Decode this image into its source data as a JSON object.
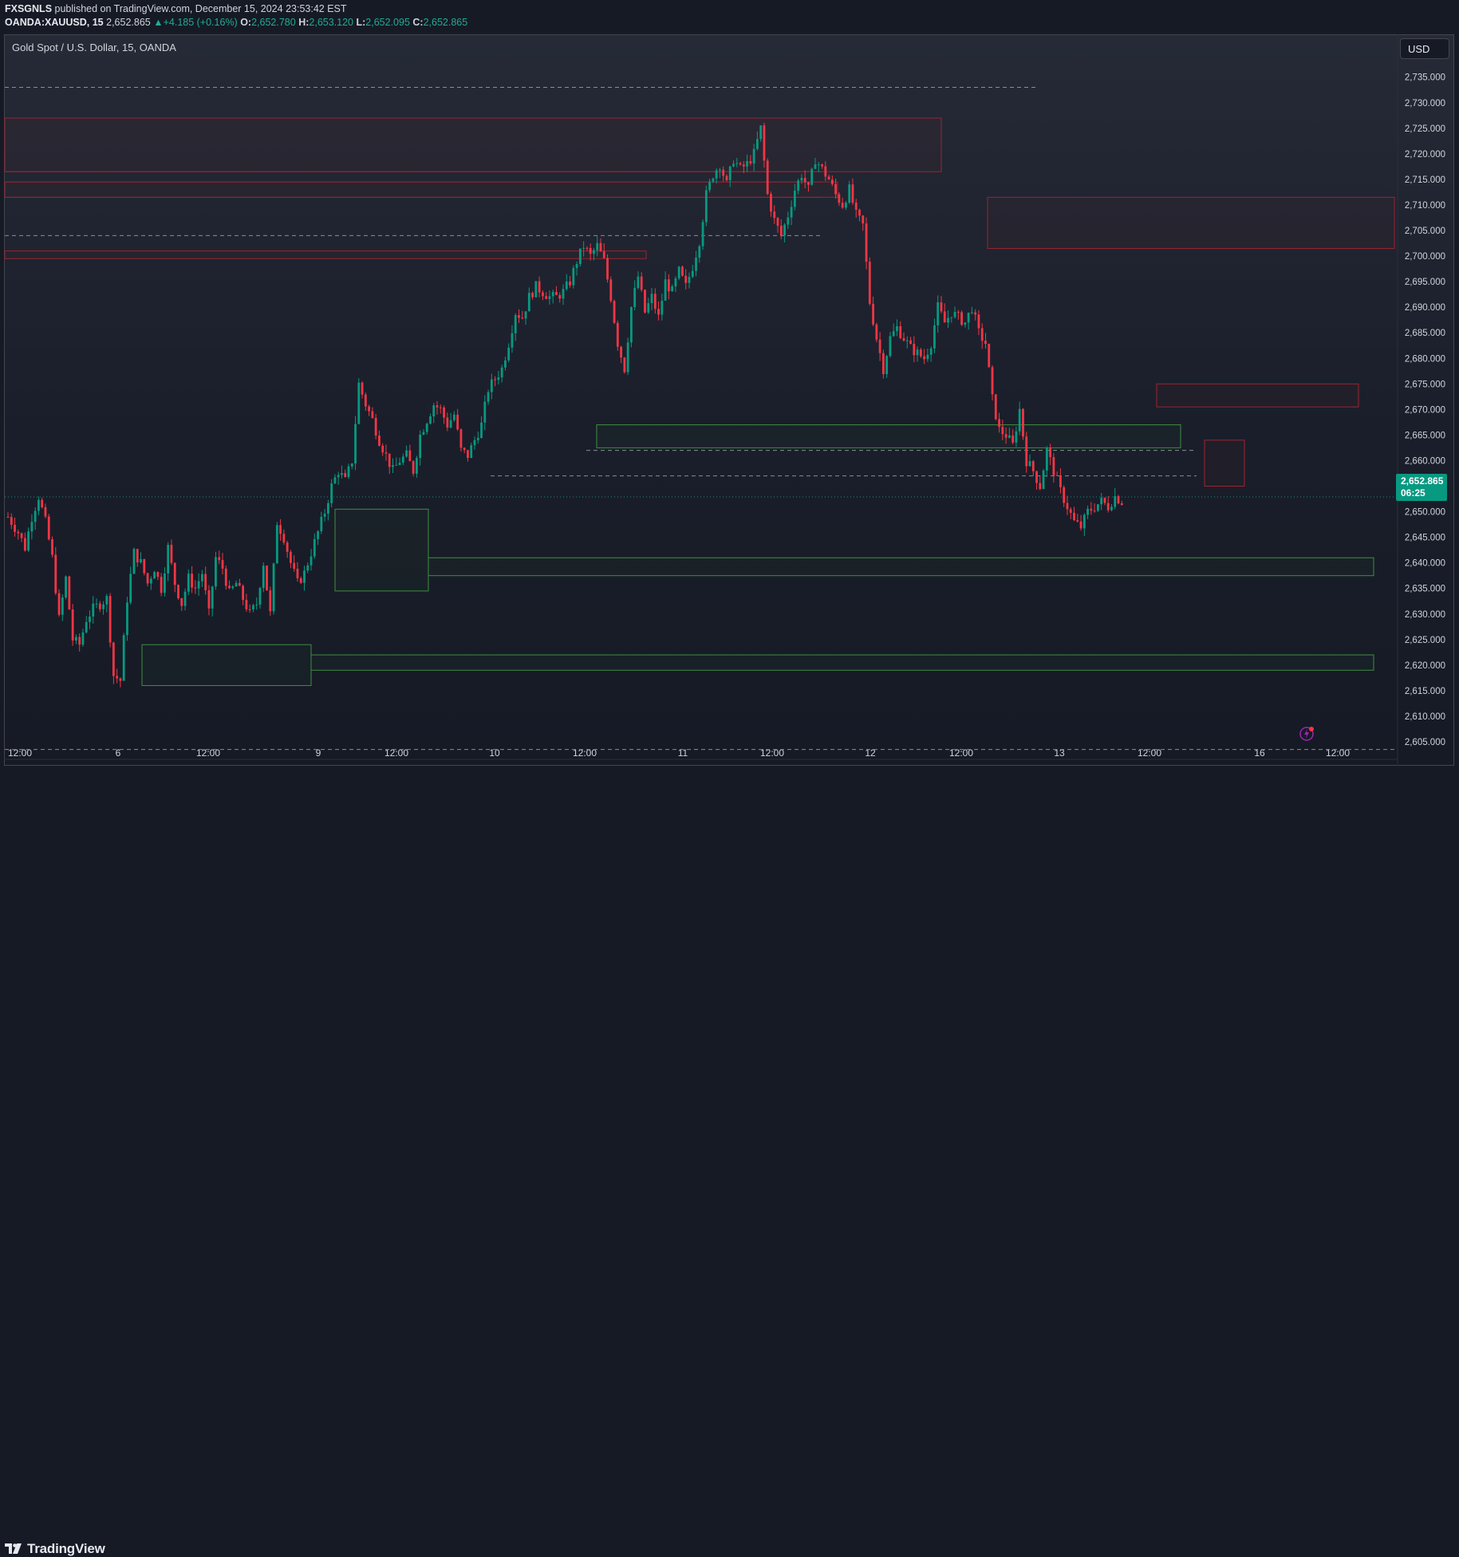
{
  "header": {
    "author": "FXSGNLS",
    "published": "published on TradingView.com, December 15, 2024 23:53:42 EST",
    "symbol": "OANDA:XAUUSD, 15",
    "last": "2,652.865",
    "change": "+4.185 (+0.16%)",
    "o_label": "O:",
    "o": "2,652.780",
    "h_label": "H:",
    "h": "2,653.120",
    "l_label": "L:",
    "l": "2,652.095",
    "c_label": "C:",
    "c": "2,652.865"
  },
  "chart_title": "Gold Spot / U.S. Dollar, 15, OANDA",
  "currency_button": "USD",
  "last_price_tag": {
    "price": "2,652.865",
    "countdown": "06:25"
  },
  "footer": {
    "brand": "TradingView"
  },
  "colors": {
    "up": "#089981",
    "down": "#f23645",
    "bg": "#161a25",
    "text": "#d1d4dc",
    "zone_green": "#3e8e41",
    "zone_red": "#9b2430"
  },
  "chart_data": {
    "type": "candlestick",
    "ylim": [
      2603,
      2736
    ],
    "y_ticks": [
      "2,605.000",
      "2,610.000",
      "2,615.000",
      "2,620.000",
      "2,625.000",
      "2,630.000",
      "2,635.000",
      "2,640.000",
      "2,645.000",
      "2,650.000",
      "2,655.000",
      "2,660.000",
      "2,665.000",
      "2,670.000",
      "2,675.000",
      "2,680.000",
      "2,685.000",
      "2,690.000",
      "2,695.000",
      "2,700.000",
      "2,705.000",
      "2,710.000",
      "2,715.000",
      "2,720.000",
      "2,725.000",
      "2,730.000",
      "2,735.000"
    ],
    "x_ticks": [
      "12:00",
      "6",
      "12:00",
      "9",
      "12:00",
      "10",
      "12:00",
      "11",
      "12:00",
      "12",
      "12:00",
      "13",
      "12:00",
      "16",
      "12:00"
    ],
    "price_path": [
      [
        0,
        2649
      ],
      [
        3,
        2646
      ],
      [
        5,
        2643
      ],
      [
        7,
        2649
      ],
      [
        9,
        2653
      ],
      [
        11,
        2648
      ],
      [
        13,
        2641
      ],
      [
        15,
        2629
      ],
      [
        17,
        2637
      ],
      [
        19,
        2625
      ],
      [
        21,
        2624
      ],
      [
        23,
        2629
      ],
      [
        25,
        2631
      ],
      [
        27,
        2632
      ],
      [
        29,
        2633
      ],
      [
        31,
        2618
      ],
      [
        33,
        2617
      ],
      [
        35,
        2633
      ],
      [
        37,
        2642
      ],
      [
        39,
        2640
      ],
      [
        41,
        2636
      ],
      [
        43,
        2639
      ],
      [
        45,
        2635
      ],
      [
        47,
        2643
      ],
      [
        49,
        2636
      ],
      [
        51,
        2632
      ],
      [
        53,
        2637
      ],
      [
        55,
        2635
      ],
      [
        57,
        2638
      ],
      [
        59,
        2630
      ],
      [
        61,
        2641
      ],
      [
        63,
        2639
      ],
      [
        65,
        2634
      ],
      [
        67,
        2636
      ],
      [
        69,
        2633
      ],
      [
        71,
        2630
      ],
      [
        73,
        2632
      ],
      [
        75,
        2640
      ],
      [
        77,
        2630
      ],
      [
        79,
        2648
      ],
      [
        81,
        2645
      ],
      [
        83,
        2640
      ],
      [
        85,
        2636
      ],
      [
        87,
        2638
      ],
      [
        89,
        2642
      ],
      [
        91,
        2646
      ],
      [
        93,
        2650
      ],
      [
        95,
        2655
      ],
      [
        97,
        2658
      ],
      [
        99,
        2656
      ],
      [
        101,
        2660
      ],
      [
        103,
        2675
      ],
      [
        105,
        2671
      ],
      [
        107,
        2668
      ],
      [
        109,
        2664
      ],
      [
        111,
        2661
      ],
      [
        113,
        2658
      ],
      [
        115,
        2660
      ],
      [
        117,
        2661
      ],
      [
        119,
        2658
      ],
      [
        121,
        2665
      ],
      [
        123,
        2668
      ],
      [
        125,
        2671
      ],
      [
        127,
        2670
      ],
      [
        129,
        2667
      ],
      [
        131,
        2669
      ],
      [
        133,
        2662
      ],
      [
        135,
        2661
      ],
      [
        137,
        2664
      ],
      [
        139,
        2667
      ],
      [
        141,
        2674
      ],
      [
        143,
        2676
      ],
      [
        145,
        2678
      ],
      [
        147,
        2683
      ],
      [
        149,
        2689
      ],
      [
        151,
        2688
      ],
      [
        153,
        2692
      ],
      [
        155,
        2694
      ],
      [
        157,
        2693
      ],
      [
        159,
        2692
      ],
      [
        161,
        2692
      ],
      [
        163,
        2693
      ],
      [
        165,
        2695
      ],
      [
        167,
        2699
      ],
      [
        169,
        2702
      ],
      [
        171,
        2700
      ],
      [
        173,
        2702
      ],
      [
        175,
        2699
      ],
      [
        177,
        2692
      ],
      [
        179,
        2683
      ],
      [
        181,
        2678
      ],
      [
        183,
        2690
      ],
      [
        185,
        2696
      ],
      [
        187,
        2689
      ],
      [
        189,
        2692
      ],
      [
        191,
        2688
      ],
      [
        193,
        2695
      ],
      [
        195,
        2693
      ],
      [
        197,
        2697
      ],
      [
        199,
        2694
      ],
      [
        201,
        2698
      ],
      [
        203,
        2703
      ],
      [
        205,
        2712
      ],
      [
        207,
        2716
      ],
      [
        209,
        2718
      ],
      [
        211,
        2714
      ],
      [
        213,
        2719
      ],
      [
        215,
        2717
      ],
      [
        217,
        2718
      ],
      [
        219,
        2720
      ],
      [
        221,
        2725
      ],
      [
        223,
        2712
      ],
      [
        225,
        2707
      ],
      [
        227,
        2704
      ],
      [
        229,
        2708
      ],
      [
        231,
        2713
      ],
      [
        233,
        2716
      ],
      [
        235,
        2713
      ],
      [
        237,
        2719
      ],
      [
        239,
        2717
      ],
      [
        241,
        2715
      ],
      [
        243,
        2712
      ],
      [
        245,
        2710
      ],
      [
        247,
        2713
      ],
      [
        249,
        2708
      ],
      [
        251,
        2706
      ],
      [
        253,
        2691
      ],
      [
        255,
        2684
      ],
      [
        257,
        2678
      ],
      [
        259,
        2684
      ],
      [
        261,
        2686
      ],
      [
        263,
        2684
      ],
      [
        265,
        2682
      ],
      [
        267,
        2681
      ],
      [
        269,
        2680
      ],
      [
        271,
        2683
      ],
      [
        273,
        2690
      ],
      [
        275,
        2687
      ],
      [
        277,
        2689
      ],
      [
        279,
        2688
      ],
      [
        281,
        2687
      ],
      [
        283,
        2690
      ],
      [
        285,
        2685
      ],
      [
        287,
        2683
      ],
      [
        289,
        2672
      ],
      [
        291,
        2666
      ],
      [
        293,
        2665
      ],
      [
        295,
        2663
      ],
      [
        297,
        2670
      ],
      [
        299,
        2660
      ],
      [
        301,
        2658
      ],
      [
        303,
        2655
      ],
      [
        305,
        2662
      ],
      [
        307,
        2658
      ],
      [
        309,
        2654
      ],
      [
        311,
        2651
      ],
      [
        313,
        2648
      ],
      [
        315,
        2647
      ],
      [
        317,
        2650
      ],
      [
        319,
        2651
      ],
      [
        321,
        2652
      ],
      [
        323,
        2651
      ],
      [
        325,
        2653
      ],
      [
        327,
        2652
      ]
    ],
    "zones": [
      {
        "kind": "supply",
        "ymin": 2716.5,
        "ymax": 2727
      },
      {
        "kind": "supply",
        "ymin": 2711.5,
        "ymax": 2714.5
      },
      {
        "kind": "supply",
        "ymin": 2699.5,
        "ymax": 2701
      },
      {
        "kind": "supply",
        "ymin": 2701.5,
        "ymax": 2711.5
      },
      {
        "kind": "supply",
        "ymin": 2670.5,
        "ymax": 2675
      },
      {
        "kind": "supply",
        "ymin": 2655,
        "ymax": 2664
      },
      {
        "kind": "demand",
        "ymin": 2662.5,
        "ymax": 2667
      },
      {
        "kind": "demand",
        "ymin": 2634.5,
        "ymax": 2650.5
      },
      {
        "kind": "demand",
        "ymin": 2616,
        "ymax": 2624
      },
      {
        "kind": "demand",
        "ymin": 2637.5,
        "ymax": 2641
      },
      {
        "kind": "demand",
        "ymin": 2619,
        "ymax": 2622
      }
    ],
    "level_lines": [
      2733,
      2704,
      2657,
      2662,
      2603.5,
      2652.9
    ]
  }
}
